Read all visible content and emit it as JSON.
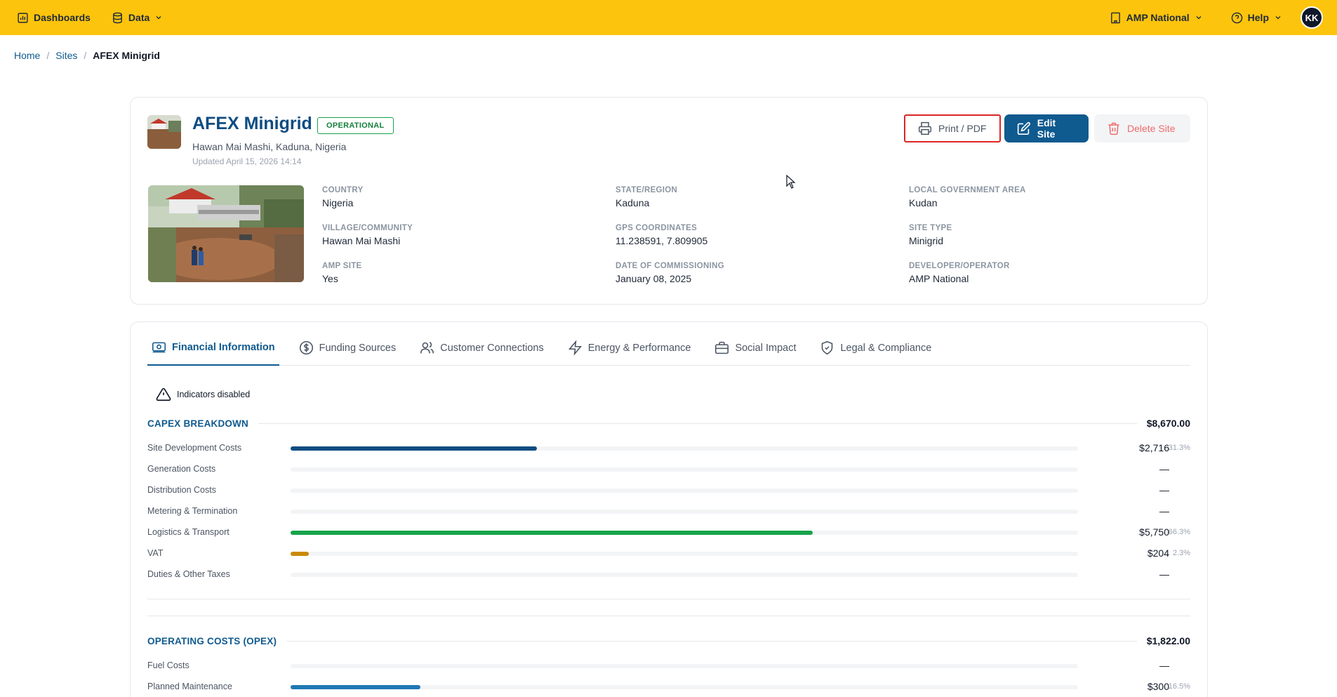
{
  "topbar": {
    "dashboards": "Dashboards",
    "data": "Data",
    "org": "AMP National",
    "help": "Help",
    "avatar": "KK"
  },
  "breadcrumb": {
    "home": "Home",
    "sites": "Sites",
    "current": "AFEX Minigrid"
  },
  "site": {
    "title": "AFEX Minigrid",
    "status": "OPERATIONAL",
    "location": "Hawan Mai Mashi, Kaduna, Nigeria",
    "updated": "Updated April 15, 2026 14:14",
    "actions": {
      "print": "Print / PDF",
      "edit": "Edit Site",
      "delete": "Delete Site"
    },
    "details": [
      {
        "label": "COUNTRY",
        "value": "Nigeria"
      },
      {
        "label": "STATE/REGION",
        "value": "Kaduna"
      },
      {
        "label": "LOCAL GOVERNMENT AREA",
        "value": "Kudan"
      },
      {
        "label": "VILLAGE/COMMUNITY",
        "value": "Hawan Mai Mashi"
      },
      {
        "label": "GPS COORDINATES",
        "value": "11.238591, 7.809905"
      },
      {
        "label": "SITE TYPE",
        "value": "Minigrid"
      },
      {
        "label": "AMP SITE",
        "value": "Yes"
      },
      {
        "label": "DATE OF COMMISSIONING",
        "value": "January 08, 2025"
      },
      {
        "label": "DEVELOPER/OPERATOR",
        "value": "AMP National"
      }
    ]
  },
  "tabs": [
    {
      "label": "Financial Information",
      "icon": "money-icon",
      "active": true
    },
    {
      "label": "Funding Sources",
      "icon": "dollar-circle-icon",
      "active": false
    },
    {
      "label": "Customer Connections",
      "icon": "users-icon",
      "active": false
    },
    {
      "label": "Energy & Performance",
      "icon": "lightning-icon",
      "active": false
    },
    {
      "label": "Social Impact",
      "icon": "briefcase-icon",
      "active": false
    },
    {
      "label": "Legal & Compliance",
      "icon": "shield-check-icon",
      "active": false
    }
  ],
  "financial": {
    "indicators_notice": "Indicators disabled",
    "capex": {
      "title": "CAPEX BREAKDOWN",
      "total": "$8,670.00",
      "rows": [
        {
          "label": "Site Development Costs",
          "amount": "$2,716",
          "percent": "31.3%",
          "share": 0.313,
          "color": "#0f4c81"
        },
        {
          "label": "Generation Costs",
          "amount": "—",
          "percent": "",
          "share": 0,
          "color": ""
        },
        {
          "label": "Distribution Costs",
          "amount": "—",
          "percent": "",
          "share": 0,
          "color": ""
        },
        {
          "label": "Metering & Termination",
          "amount": "—",
          "percent": "",
          "share": 0,
          "color": ""
        },
        {
          "label": "Logistics & Transport",
          "amount": "$5,750",
          "percent": "66.3%",
          "share": 0.663,
          "color": "#16a34a"
        },
        {
          "label": "VAT",
          "amount": "$204",
          "percent": "2.3%",
          "share": 0.023,
          "color": "#ca8a04"
        },
        {
          "label": "Duties & Other Taxes",
          "amount": "—",
          "percent": "",
          "share": 0,
          "color": ""
        }
      ]
    },
    "opex": {
      "title": "OPERATING COSTS (OPEX)",
      "total": "$1,822.00",
      "rows": [
        {
          "label": "Fuel Costs",
          "amount": "—",
          "percent": "",
          "share": 0,
          "color": ""
        },
        {
          "label": "Planned Maintenance",
          "amount": "$300",
          "percent": "16.5%",
          "share": 0.165,
          "color": "#1f78b4"
        }
      ]
    }
  }
}
